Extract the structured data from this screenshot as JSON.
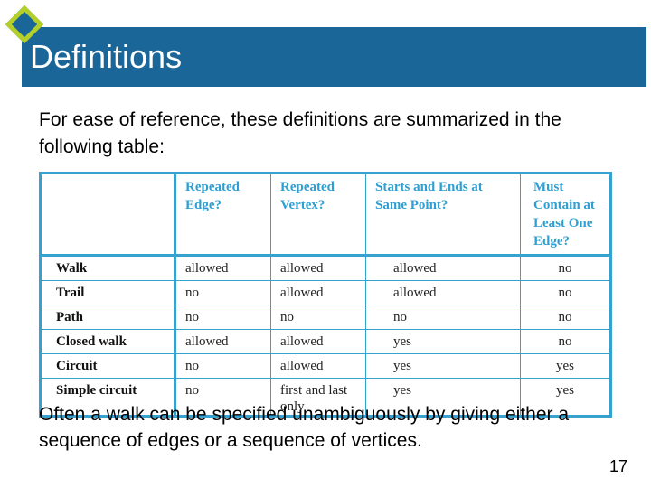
{
  "slide": {
    "title": "Definitions",
    "intro_text": "For ease of reference, these definitions are summarized in the following table:",
    "outro_text": "Often a walk can be specified unambiguously by giving either a sequence of edges or a sequence of vertices.",
    "page_number": "17",
    "colors": {
      "title_bar": "#1a6699",
      "diamond_border": "#b5cf2a",
      "table_border": "#35a2d0",
      "table_header_text": "#2d9fd2"
    }
  },
  "table": {
    "headers": [
      "",
      "Repeated Edge?",
      "Repeated Vertex?",
      "Starts and Ends at Same Point?",
      "Must Contain at Least One Edge?"
    ],
    "rows": [
      {
        "name": "Walk",
        "cells": [
          "allowed",
          "allowed",
          "allowed",
          "no"
        ]
      },
      {
        "name": "Trail",
        "cells": [
          "no",
          "allowed",
          "allowed",
          "no"
        ]
      },
      {
        "name": "Path",
        "cells": [
          "no",
          "no",
          "no",
          "no"
        ]
      },
      {
        "name": "Closed walk",
        "cells": [
          "allowed",
          "allowed",
          "yes",
          "no"
        ]
      },
      {
        "name": "Circuit",
        "cells": [
          "no",
          "allowed",
          "yes",
          "yes"
        ]
      },
      {
        "name": "Simple circuit",
        "cells": [
          "no",
          "first and last only",
          "yes",
          "yes"
        ]
      }
    ]
  }
}
